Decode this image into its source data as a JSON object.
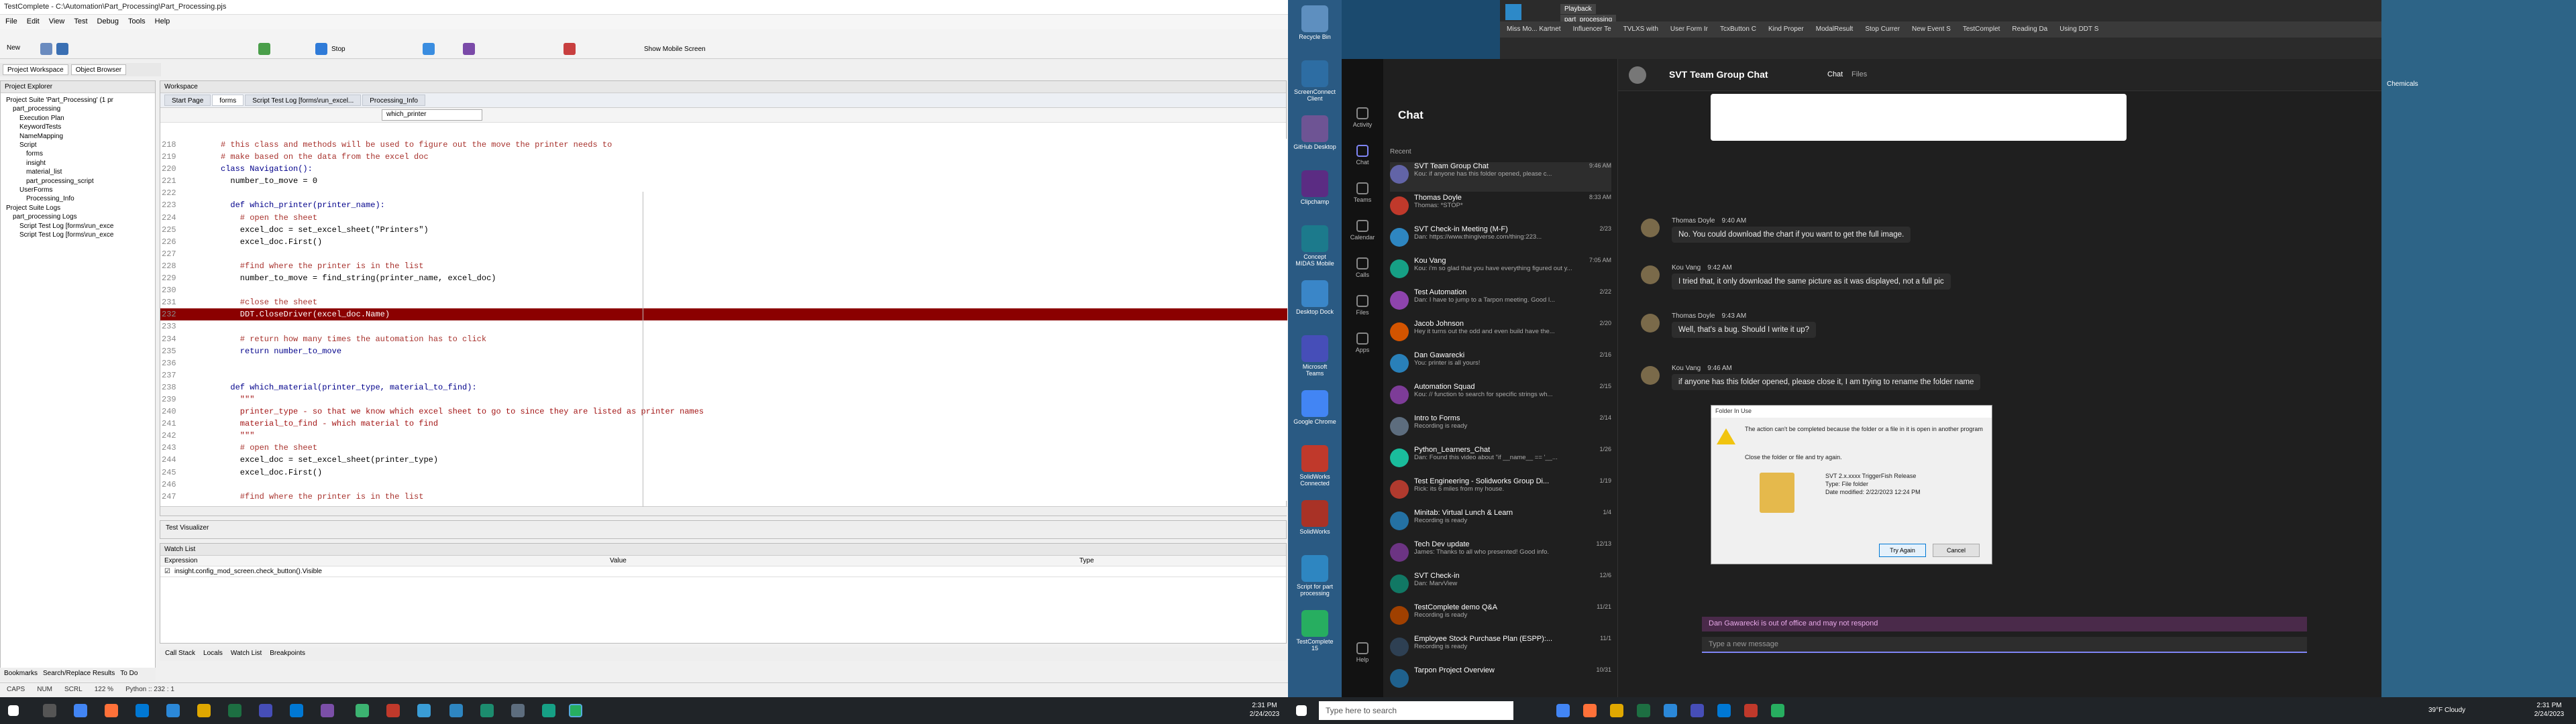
{
  "testcomplete": {
    "window_title": "TestComplete - C:\\Automation\\Part_Processing\\Part_Processing.pjs",
    "menu": [
      "File",
      "Edit",
      "View",
      "Test",
      "Debug",
      "Tools",
      "Help"
    ],
    "toolbar": {
      "new_label": "New",
      "stop_label": "Stop",
      "mobile_label": "Show Mobile Screen"
    },
    "workspace_tabs": [
      "Project Workspace",
      "Object Browser"
    ],
    "project_explorer_title": "Project Explorer",
    "tree": [
      "Project Suite 'Part_Processing' (1 pr",
      "part_processing",
      "Execution Plan",
      "KeywordTests",
      "NameMapping",
      "Script",
      "forms",
      "insight",
      "material_list",
      "part_processing_script",
      "UserForms",
      "Processing_Info",
      "Project Suite Logs",
      "part_processing Logs",
      "Script Test Log [forms\\run_exce",
      "Script Test Log [forms\\run_exce"
    ],
    "workspace_title": "Workspace",
    "editor_tabs": [
      "Start Page",
      "forms",
      "Script Test Log [forms\\run_excel...",
      "Processing_Info"
    ],
    "function_dropdown": "which_printer",
    "code_lines": [
      {
        "n": "218",
        "t": "# this class and methods will be used to figure out the move the printer needs to",
        "c": "cm"
      },
      {
        "n": "219",
        "t": "# make based on the data from the excel doc",
        "c": "cm"
      },
      {
        "n": "220",
        "t": "class Navigation():",
        "c": "kw"
      },
      {
        "n": "221",
        "t": "  number_to_move = 0",
        "c": ""
      },
      {
        "n": "222",
        "t": "",
        "c": ""
      },
      {
        "n": "223",
        "t": "  def which_printer(printer_name):",
        "c": "kw"
      },
      {
        "n": "224",
        "t": "    # open the sheet",
        "c": "cm"
      },
      {
        "n": "225",
        "t": "    excel_doc = set_excel_sheet(\"Printers\")",
        "c": ""
      },
      {
        "n": "226",
        "t": "    excel_doc.First()",
        "c": ""
      },
      {
        "n": "227",
        "t": "",
        "c": ""
      },
      {
        "n": "228",
        "t": "    #find where the printer is in the list",
        "c": "cm"
      },
      {
        "n": "229",
        "t": "    number_to_move = find_string(printer_name, excel_doc)",
        "c": ""
      },
      {
        "n": "230",
        "t": "",
        "c": ""
      },
      {
        "n": "231",
        "t": "    #close the sheet",
        "c": "cm"
      },
      {
        "n": "232",
        "t": "    DDT.CloseDriver(excel_doc.Name)",
        "c": "hl"
      },
      {
        "n": "233",
        "t": "",
        "c": ""
      },
      {
        "n": "234",
        "t": "    # return how many times the automation has to click",
        "c": "cm"
      },
      {
        "n": "235",
        "t": "    return number_to_move",
        "c": "kw"
      },
      {
        "n": "236",
        "t": "",
        "c": ""
      },
      {
        "n": "237",
        "t": "",
        "c": ""
      },
      {
        "n": "238",
        "t": "  def which_material(printer_type, material_to_find):",
        "c": "kw"
      },
      {
        "n": "239",
        "t": "    \"\"\"",
        "c": "str"
      },
      {
        "n": "240",
        "t": "    printer_type - so that we know which excel sheet to go to since they are listed as printer names",
        "c": "str"
      },
      {
        "n": "241",
        "t": "    material_to_find - which material to find",
        "c": "str"
      },
      {
        "n": "242",
        "t": "    \"\"\"",
        "c": "str"
      },
      {
        "n": "243",
        "t": "    # open the sheet",
        "c": "cm"
      },
      {
        "n": "244",
        "t": "    excel_doc = set_excel_sheet(printer_type)",
        "c": ""
      },
      {
        "n": "245",
        "t": "    excel_doc.First()",
        "c": ""
      },
      {
        "n": "246",
        "t": "",
        "c": ""
      },
      {
        "n": "247",
        "t": "    #find where the printer is in the list",
        "c": "cm"
      }
    ],
    "test_visualizer": "Test Visualizer",
    "watch_title": "Watch List",
    "watch_headers": [
      "Expression",
      "Value",
      "Type"
    ],
    "watch_row": "insight.config_mod_screen.check_button().Visible",
    "bottom_tabs": [
      "Call Stack",
      "Locals",
      "Watch List",
      "Breakpoints"
    ],
    "bookmark_tabs": [
      "Bookmarks",
      "Search/Replace Results",
      "To Do"
    ],
    "status": [
      "CAPS",
      "NUM",
      "SCRL",
      "122 %",
      "Python :: 232 : 1"
    ],
    "clock": {
      "time": "2:31 PM",
      "date": "2/24/2023"
    }
  },
  "desktop_icons": [
    "Recycle Bin",
    "ScreenConnect Client",
    "GitHub Desktop",
    "Clipchamp",
    "Concept MIDAS Mobile",
    "Desktop Dock",
    "Microsoft Teams",
    "Google Chrome",
    "SolidWorks Connected",
    "SolidWorks",
    "Script for part processing",
    "TestComplete 15"
  ],
  "browser": {
    "tabs": [
      "Miss Mo... Kartnet",
      "Influencer Te",
      "TVLXS with",
      "User Form Ir",
      "TcxButton C",
      "Kind Proper",
      "ModalResult",
      "Stop Currer",
      "New Event S",
      "TestComplet",
      "Reading Da",
      "Using DDT S"
    ],
    "playback": "Playback",
    "process": "part_processing",
    "right_label": "Chemicals"
  },
  "teams": {
    "rail": [
      "Activity",
      "Chat",
      "Teams",
      "Calendar",
      "Calls",
      "Files",
      "Apps",
      "Help"
    ],
    "chat_title": "Chat",
    "recent_label": "Recent",
    "chats": [
      {
        "name": "SVT Team Group Chat",
        "prev": "Kou: if anyone has this folder opened, please c...",
        "time": "9:46 AM"
      },
      {
        "name": "Thomas Doyle",
        "prev": "Thomas: *STOP*",
        "time": "8:33 AM"
      },
      {
        "name": "SVT Check-in Meeting (M-F)",
        "prev": "Dan: https://www.thingiverse.com/thing:223...",
        "time": "2/23"
      },
      {
        "name": "Kou Vang",
        "prev": "Kou: i'm so glad that you have everything figured out y...",
        "time": "7:05 AM"
      },
      {
        "name": "Test Automation",
        "prev": "Dan: I have to jump to a Tarpon meeting. Good l...",
        "time": "2/22"
      },
      {
        "name": "Jacob Johnson",
        "prev": "Hey it turns out the odd and even build have the...",
        "time": "2/20"
      },
      {
        "name": "Dan Gawarecki",
        "prev": "You: printer is all yours!",
        "time": "2/16"
      },
      {
        "name": "Automation Squad",
        "prev": "Kou: // function to search for specific strings wh...",
        "time": "2/15"
      },
      {
        "name": "Intro to Forms",
        "prev": "Recording is ready",
        "time": "2/14"
      },
      {
        "name": "Python_Learners_Chat",
        "prev": "Dan: Found this video about \"if __name__ == '__...",
        "time": "1/26"
      },
      {
        "name": "Test Engineering - Solidworks Group Di...",
        "prev": "Rick: its 6 miles from my house.",
        "time": "1/19"
      },
      {
        "name": "Minitab: Virtual Lunch & Learn",
        "prev": "Recording is ready",
        "time": "1/4"
      },
      {
        "name": "Tech Dev update",
        "prev": "James: Thanks to all who presented! Good info.",
        "time": "12/13"
      },
      {
        "name": "SVT Check-in",
        "prev": "Dan: MarvView",
        "time": "12/6"
      },
      {
        "name": "TestComplete demo Q&A",
        "prev": "Recording is ready",
        "time": "11/21"
      },
      {
        "name": "Employee Stock Purchase Plan (ESPP):...",
        "prev": "Recording is ready",
        "time": "11/1"
      },
      {
        "name": "Tarpon Project Overview",
        "prev": "",
        "time": "10/31"
      }
    ],
    "conv_title": "SVT Team Group Chat",
    "conv_tabs": [
      "Chat",
      "Files"
    ],
    "messages": [
      {
        "who": "Thomas Doyle",
        "time": "9:40 AM",
        "text": "No. You could download the chart if you want to get the full image."
      },
      {
        "who": "Kou Vang",
        "time": "9:42 AM",
        "text": "I tried that, it only download the same picture as it was displayed, not a full pic"
      },
      {
        "who": "Thomas Doyle",
        "time": "9:43 AM",
        "text": "Well, that's a bug.  Should I write it up?"
      },
      {
        "who": "Kou Vang",
        "time": "9:46 AM",
        "text": "if anyone has this folder opened, please close it, I am trying to rename the folder name"
      }
    ],
    "dialog": {
      "title": "Folder In Use",
      "msg": "The action can't be completed because the folder or a file in it is open in another program",
      "sub": "Close the folder or file and try again.",
      "file": "SVT 2.x.xxxx TriggerFish Release",
      "type": "Type: File folder",
      "date": "Date modified: 2/22/2023 12:24 PM",
      "retry": "Try Again",
      "cancel": "Cancel"
    },
    "ooo": "Dan Gawarecki is out of office and may not respond",
    "compose": "Type a new message"
  },
  "taskbar2": {
    "search": "Type here to search",
    "weather": "39°F Cloudy",
    "time": "2:31 PM",
    "date": "2/24/2023"
  }
}
